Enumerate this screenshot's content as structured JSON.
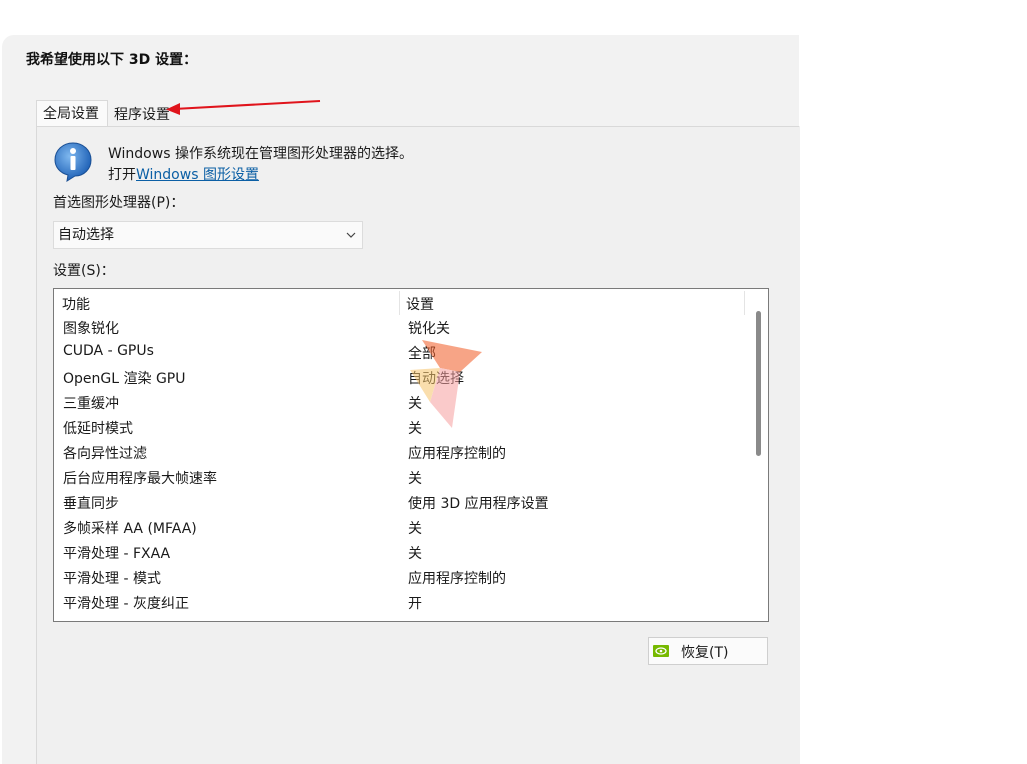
{
  "heading": "我希望使用以下 3D 设置：",
  "tabs": [
    {
      "label": "全局设置",
      "active": true
    },
    {
      "label": "程序设置",
      "active": false
    }
  ],
  "info": {
    "message": "Windows 操作系统现在管理图形处理器的选择。",
    "link_prefix": "打开",
    "link_text": "Windows 图形设置"
  },
  "gpu": {
    "label": "首选图形处理器(P)：",
    "selected": "自动选择"
  },
  "settings": {
    "label": "设置(S)：",
    "columns": [
      "功能",
      "设置"
    ],
    "rows": [
      {
        "feature": "图象锐化",
        "value": "锐化关"
      },
      {
        "feature": "CUDA - GPUs",
        "value": "全部"
      },
      {
        "feature": "OpenGL 渲染 GPU",
        "value": "自动选择"
      },
      {
        "feature": "三重缓冲",
        "value": "关"
      },
      {
        "feature": "低延时模式",
        "value": "关"
      },
      {
        "feature": "各向异性过滤",
        "value": "应用程序控制的"
      },
      {
        "feature": "后台应用程序最大帧速率",
        "value": "关"
      },
      {
        "feature": "垂直同步",
        "value": "使用 3D 应用程序设置"
      },
      {
        "feature": "多帧采样 AA (MFAA)",
        "value": "关"
      },
      {
        "feature": "平滑处理 - FXAA",
        "value": "关"
      },
      {
        "feature": "平滑处理 - 模式",
        "value": "应用程序控制的"
      },
      {
        "feature": "平滑处理 - 灰度纠正",
        "value": "开"
      }
    ]
  },
  "restore_button": "恢复(T)",
  "colors": {
    "panel_bg": "#f2f2f2",
    "link": "#0b5fa5",
    "annotation_arrow": "#e0141c",
    "nvidia_green": "#76b900"
  }
}
